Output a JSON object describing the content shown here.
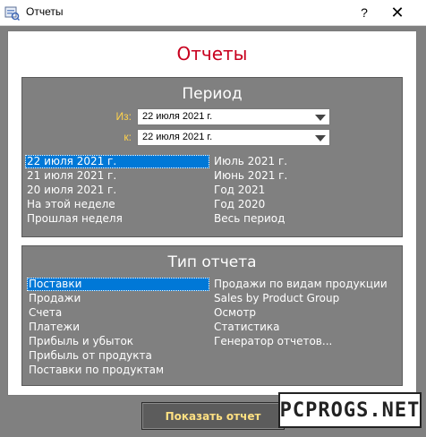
{
  "window": {
    "title": "Отчеты",
    "help_button": "?",
    "close_button": "✕",
    "icon": "report-app-icon"
  },
  "main": {
    "title": "Отчеты"
  },
  "period": {
    "title": "Период",
    "from_label": "Из:",
    "to_label": "к:",
    "from_value": "22 июля 2021 г.",
    "to_value": "22 июля 2021 г.",
    "quick_left": [
      "22 июля 2021 г.",
      "21 июля 2021 г.",
      "20 июля 2021 г.",
      "На этой неделе",
      "Прошлая неделя"
    ],
    "quick_right": [
      "Июль 2021 г.",
      "Июнь 2021 г.",
      "Год 2021",
      "Год 2020",
      "Весь период"
    ],
    "selected_index": 0
  },
  "report_type": {
    "title": "Тип отчета",
    "left": [
      "Поставки",
      "Продажи",
      "Счета",
      "Платежи",
      "Прибыль и убыток",
      "Прибыль от продукта",
      "Поставки по продуктам"
    ],
    "right": [
      "Продажи по видам продукции",
      "Sales by Product Group",
      "Осмотр",
      "Статистика",
      "Генератор отчетов..."
    ],
    "selected_index": 0
  },
  "actions": {
    "show_report": "Показать отчет"
  },
  "watermark": "PCPROGS.NET",
  "colors": {
    "title_red": "#c8001e",
    "label_yellow": "#ffd24a",
    "selection_blue": "#0078d7",
    "button_text": "#ffe082",
    "panel_gray": "#808080"
  }
}
